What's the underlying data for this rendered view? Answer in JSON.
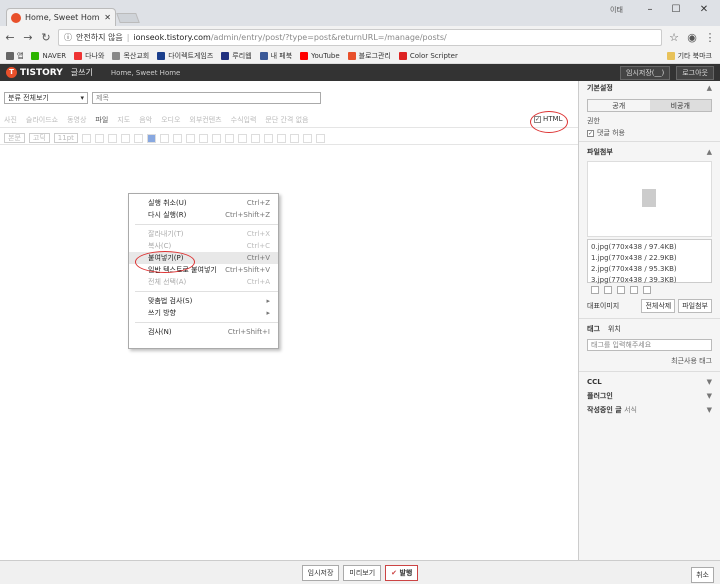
{
  "browser": {
    "tab_title": "Home, Sweet Home :: 글",
    "user_label": "이태",
    "window_min": "–",
    "window_max": "☐",
    "window_close": "✕",
    "security_label": "안전하지 않음",
    "url_host": "ionseok.tistory.com",
    "url_path": "/admin/entry/post/?type=post&returnURL=/manage/posts/",
    "bookmarks": [
      {
        "label": "앱",
        "color": "#666"
      },
      {
        "label": "NAVER",
        "color": "#2db400"
      },
      {
        "label": "다나와",
        "color": "#e33"
      },
      {
        "label": "목산교회",
        "color": "#888"
      },
      {
        "label": "다이렉트게임즈",
        "color": "#1a3e8c"
      },
      {
        "label": "루리웹",
        "color": "#203080"
      },
      {
        "label": "내 페북",
        "color": "#3b5998"
      },
      {
        "label": "YouTube",
        "color": "#f00"
      },
      {
        "label": "블로그관리",
        "color": "#e8502b"
      },
      {
        "label": "Color Scripter",
        "color": "#d22"
      }
    ],
    "other_bookmarks": "기타 북마크"
  },
  "app": {
    "logo": "TISTORY",
    "write_label": "글쓰기",
    "blog_name": "Home, Sweet Home",
    "header_buttons": [
      "임시저장(__)",
      "로그아웃"
    ]
  },
  "editor": {
    "category": "분류 전체보기",
    "title_placeholder": "제목",
    "toolbar1": [
      "사진",
      "슬라이드쇼",
      "동영상",
      "파일",
      "지도",
      "음악",
      "오디오",
      "외부컨텐츠",
      "수식입력",
      "문단 간격 없음"
    ],
    "html_label": "HTML",
    "toolbar2": [
      "본문",
      "고딕",
      "11pt"
    ]
  },
  "context_menu": [
    {
      "label": "실행 취소(U)",
      "shortcut": "Ctrl+Z",
      "disabled": false
    },
    {
      "label": "다시 실행(R)",
      "shortcut": "Ctrl+Shift+Z",
      "disabled": false
    },
    {
      "sep": true
    },
    {
      "label": "잘라내기(T)",
      "shortcut": "Ctrl+X",
      "disabled": true
    },
    {
      "label": "복사(C)",
      "shortcut": "Ctrl+C",
      "disabled": true
    },
    {
      "label": "붙여넣기(P)",
      "shortcut": "Ctrl+V",
      "disabled": false,
      "highlight": true
    },
    {
      "label": "일반 텍스트로 붙여넣기",
      "shortcut": "Ctrl+Shift+V",
      "disabled": false
    },
    {
      "label": "전체 선택(A)",
      "shortcut": "Ctrl+A",
      "disabled": true
    },
    {
      "sep": true
    },
    {
      "label": "맞춤법 검사(S)",
      "shortcut": "▸",
      "disabled": false
    },
    {
      "label": "쓰기 방향",
      "shortcut": "▸",
      "disabled": false
    },
    {
      "sep": true
    },
    {
      "label": "검사(N)",
      "shortcut": "Ctrl+Shift+I",
      "disabled": false
    }
  ],
  "panel": {
    "basic_settings": "기본설정",
    "visibility_public": "공개",
    "visibility_private": "비공개",
    "permission_label": "권한",
    "allow_comments": "댓글 허용",
    "attachments_label": "파일첨부",
    "files": [
      "0.jpg(770x438 / 97.4KB)",
      "1.jpg(770x438 / 22.9KB)",
      "2.jpg(770x438 / 95.3KB)",
      "3.jpg(770x438 / 39.3KB)"
    ],
    "rep_image": "대표이미지",
    "delete_all": "전체삭제",
    "upload_files": "파일첨부",
    "tag_tab": "태그",
    "location_tab": "위치",
    "tag_placeholder": "태그를 입력해주세요",
    "recent_tags": "최근사용 태그",
    "ccl_label": "CCL",
    "plugin_label": "플러그인",
    "related_label": "작성중인 글",
    "related_sub": "서식"
  },
  "footer": {
    "temp_save": "임시저장",
    "preview": "미리보기",
    "publish": "발행",
    "cancel": "취소"
  }
}
